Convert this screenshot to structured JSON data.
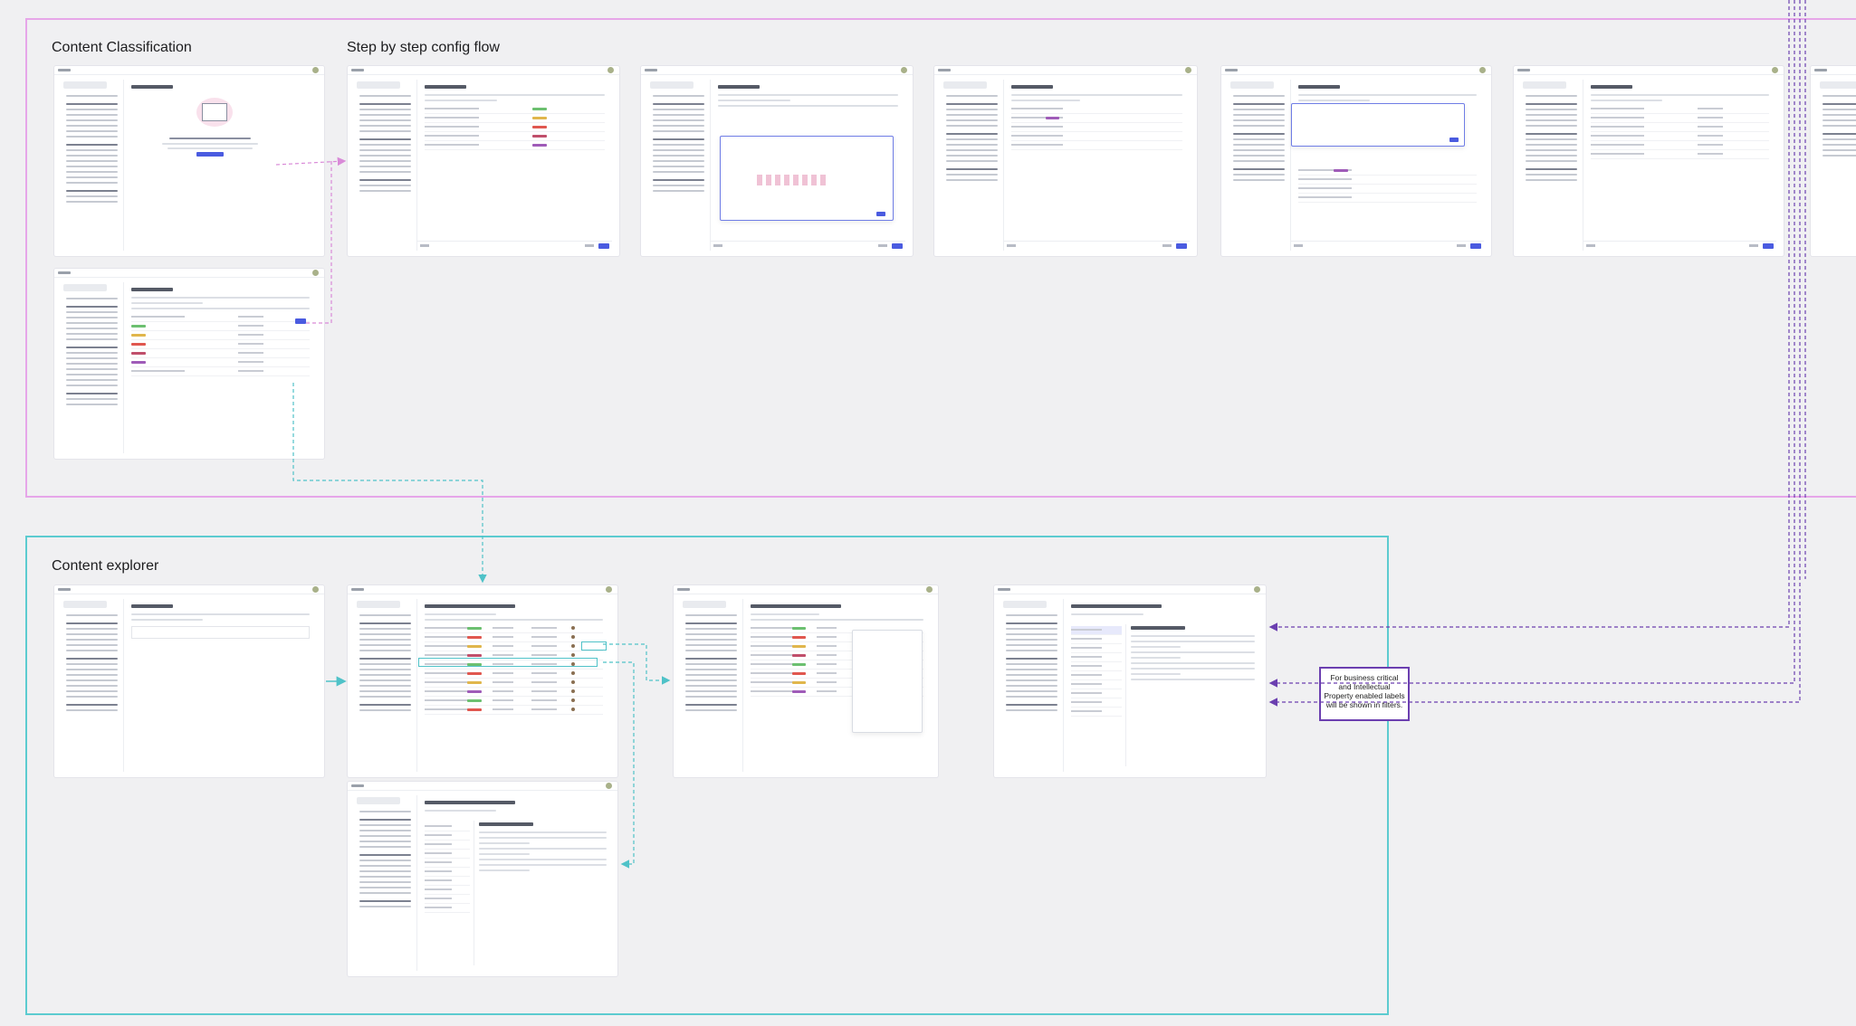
{
  "sections": {
    "content_classification": {
      "title": "Content Classification"
    },
    "config_flow": {
      "title": "Step by step config flow"
    },
    "content_explorer": {
      "title": "Content explorer"
    }
  },
  "note": {
    "text": "For business critical and Intellectual Property enabled labels will be shown in filters."
  },
  "colors": {
    "classification_frame": "#e6a6e9",
    "explorer_frame": "#5ccbd0",
    "note_border": "#6b3fb0",
    "connector_pink": "#d98ad8",
    "connector_teal": "#4fc2c8",
    "connector_purple": "#6b3fb0",
    "primary_button": "#4a5be0"
  }
}
